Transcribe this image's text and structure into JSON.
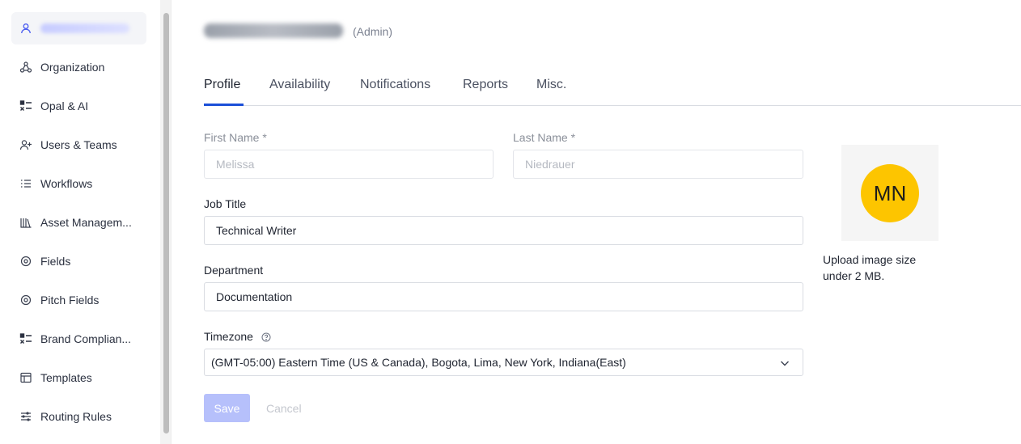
{
  "sidebar": {
    "items": [
      {
        "label": "",
        "icon": "user-icon",
        "active": true
      },
      {
        "label": "Organization",
        "icon": "organization-icon"
      },
      {
        "label": "Opal & AI",
        "icon": "checklist-icon"
      },
      {
        "label": "Users & Teams",
        "icon": "add-user-icon"
      },
      {
        "label": "Workflows",
        "icon": "workflow-list-icon"
      },
      {
        "label": "Asset Managem...",
        "icon": "library-icon"
      },
      {
        "label": "Fields",
        "icon": "field-icon"
      },
      {
        "label": "Pitch Fields",
        "icon": "field-icon"
      },
      {
        "label": "Brand Complian...",
        "icon": "checklist-icon"
      },
      {
        "label": "Templates",
        "icon": "template-icon"
      },
      {
        "label": "Routing Rules",
        "icon": "routing-icon"
      }
    ]
  },
  "header": {
    "role": "(Admin)"
  },
  "tabs": [
    {
      "label": "Profile",
      "active": true
    },
    {
      "label": "Availability"
    },
    {
      "label": "Notifications"
    },
    {
      "label": "Reports"
    },
    {
      "label": "Misc."
    }
  ],
  "form": {
    "first_name": {
      "label": "First Name *",
      "value": "Melissa"
    },
    "last_name": {
      "label": "Last Name *",
      "value": "Niedrauer"
    },
    "job_title": {
      "label": "Job Title",
      "value": "Technical Writer"
    },
    "department": {
      "label": "Department",
      "value": "Documentation"
    },
    "timezone": {
      "label": "Timezone",
      "value": "(GMT-05:00) Eastern Time (US & Canada), Bogota, Lima, New York, Indiana(East)"
    },
    "save_label": "Save",
    "cancel_label": "Cancel"
  },
  "avatar": {
    "initials": "MN",
    "color": "#fdc500",
    "upload_note": "Upload image size under 2 MB."
  },
  "colors": {
    "accent": "#1b4fd8",
    "save_disabled": "#b6c0fb"
  }
}
